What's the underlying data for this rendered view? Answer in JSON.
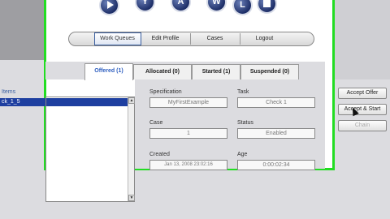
{
  "logo": {
    "letters": [
      "Y",
      "A",
      "W",
      "L"
    ]
  },
  "nav": {
    "items": [
      {
        "label": "Work Queues",
        "active": true
      },
      {
        "label": "Edit Profile",
        "active": false
      },
      {
        "label": "Cases",
        "active": false
      },
      {
        "label": "Logout",
        "active": false
      }
    ]
  },
  "tabs": [
    {
      "label": "Offered (1)",
      "active": true
    },
    {
      "label": "Allocated (0)",
      "active": false
    },
    {
      "label": "Started (1)",
      "active": false
    },
    {
      "label": "Suspended (0)",
      "active": false
    }
  ],
  "left_panel": {
    "header": "Items",
    "selected_item": "ck_1_5"
  },
  "details": {
    "specification_label": "Specification",
    "specification_value": "MyFirstExample",
    "task_label": "Task",
    "task_value": "Check 1",
    "case_label": "Case",
    "case_value": "1",
    "status_label": "Status",
    "status_value": "Enabled",
    "created_label": "Created",
    "created_value": "Jan 13, 2008 23:02:16",
    "age_label": "Age",
    "age_value": "0:00:02:34"
  },
  "actions": {
    "accept_offer": "Accept Offer",
    "accept_start": "Accept & Start",
    "chain": "Chain"
  },
  "colors": {
    "highlight_border": "#22dd22",
    "selection": "#1e3fa0",
    "active_tab_text": "#3060c0"
  }
}
